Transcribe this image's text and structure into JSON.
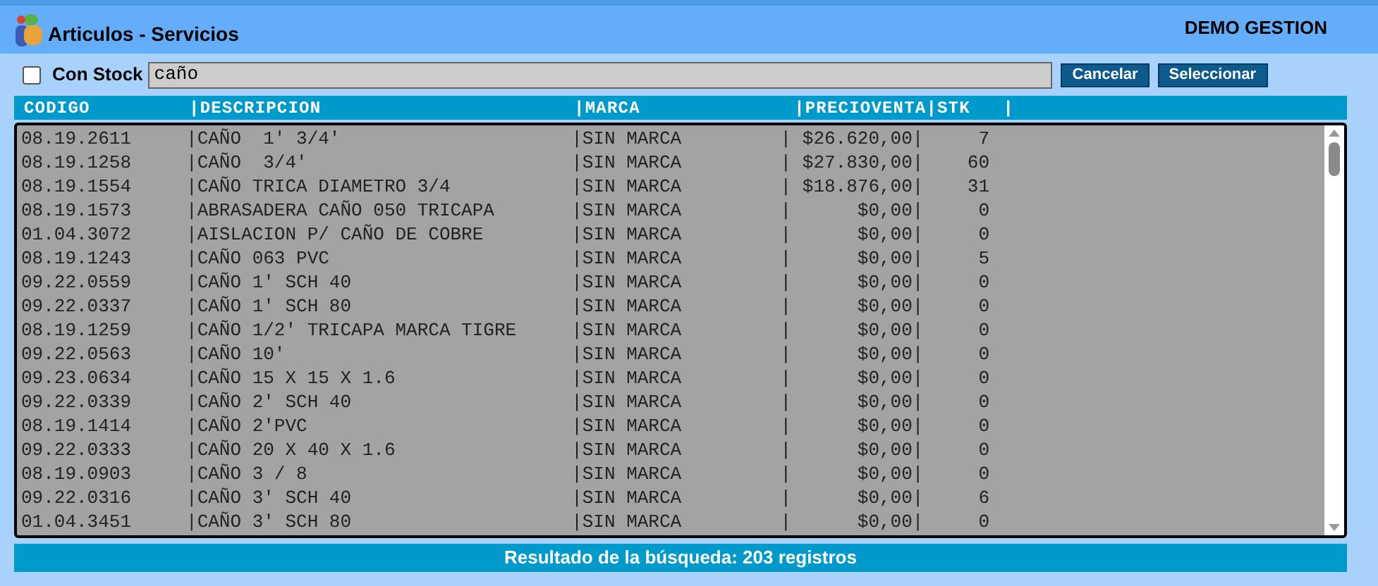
{
  "window": {
    "title": "Articulos - Servicios",
    "company": "DEMO GESTION"
  },
  "filter": {
    "con_stock": {
      "label": "Con Stock",
      "checked": false
    },
    "search_value": "caño"
  },
  "buttons": [
    "Cancelar",
    "Seleccionar"
  ],
  "list_header": "CODIGO         |DESCRIPCION                       |MARCA              |PRECIOVENTA|STK   |",
  "rows": [
    "08.19.2611     |CAÑO  1' 3/4'                     |SIN MARCA         | $26.620,00|     7",
    "08.19.1258     |CAÑO  3/4'                        |SIN MARCA         | $27.830,00|    60",
    "08.19.1554     |CAÑO TRICA DIAMETRO 3/4           |SIN MARCA         | $18.876,00|    31",
    "08.19.1573     |ABRASADERA CAÑO 050 TRICAPA       |SIN MARCA         |      $0,00|     0",
    "01.04.3072     |AISLACION P/ CAÑO DE COBRE        |SIN MARCA         |      $0,00|     0",
    "08.19.1243     |CAÑO 063 PVC                      |SIN MARCA         |      $0,00|     5",
    "09.22.0559     |CAÑO 1' SCH 40                    |SIN MARCA         |      $0,00|     0",
    "09.22.0337     |CAÑO 1' SCH 80                    |SIN MARCA         |      $0,00|     0",
    "08.19.1259     |CAÑO 1/2' TRICAPA MARCA TIGRE     |SIN MARCA         |      $0,00|     0",
    "09.22.0563     |CAÑO 10'                          |SIN MARCA         |      $0,00|     0",
    "09.23.0634     |CAÑO 15 X 15 X 1.6                |SIN MARCA         |      $0,00|     0",
    "09.22.0339     |CAÑO 2' SCH 40                    |SIN MARCA         |      $0,00|     0",
    "08.19.1414     |CAÑO 2'PVC                        |SIN MARCA         |      $0,00|     0",
    "09.22.0333     |CAÑO 20 X 40 X 1.6                |SIN MARCA         |      $0,00|     0",
    "08.19.0903     |CAÑO 3 / 8                        |SIN MARCA         |      $0,00|     0",
    "09.22.0316     |CAÑO 3' SCH 40                    |SIN MARCA         |      $0,00|     6",
    "01.04.3451     |CAÑO 3' SCH 80                    |SIN MARCA         |      $0,00|     0"
  ],
  "status_bar": "Resultado de la búsqueda: 203 registros"
}
